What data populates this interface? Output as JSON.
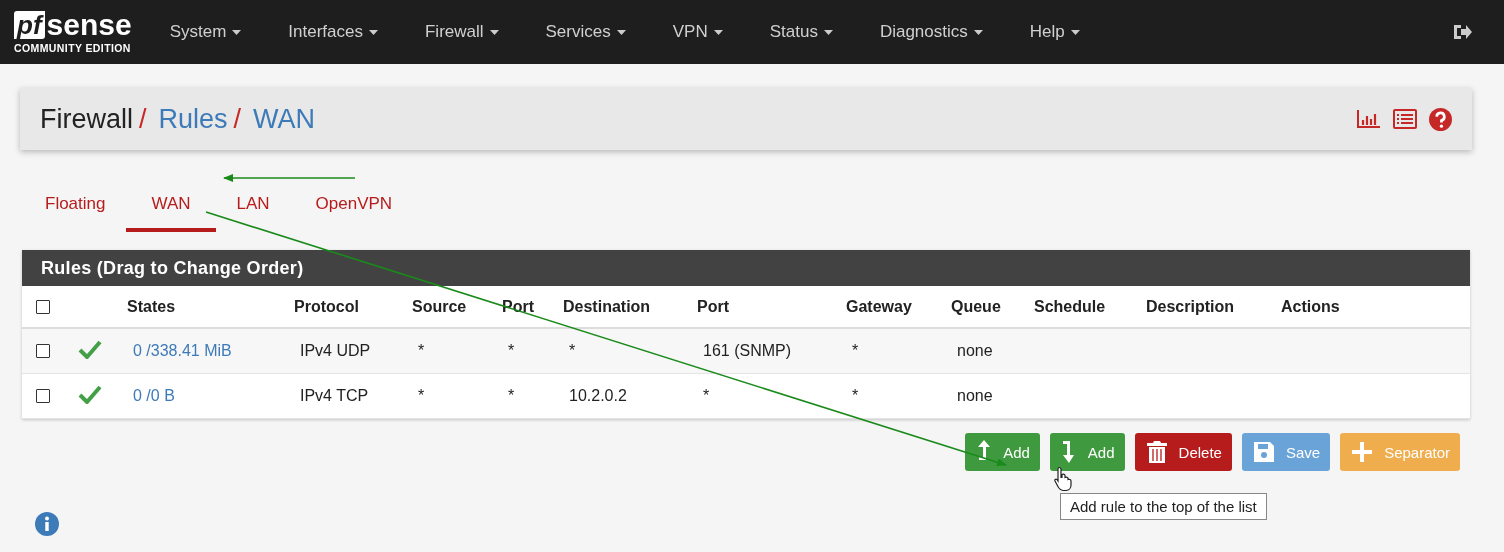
{
  "navbar": {
    "logo": {
      "mark": "pf",
      "word": "sense",
      "edition": "COMMUNITY EDITION"
    },
    "menus": [
      {
        "label": "System"
      },
      {
        "label": "Interfaces"
      },
      {
        "label": "Firewall"
      },
      {
        "label": "Services"
      },
      {
        "label": "VPN"
      },
      {
        "label": "Status"
      },
      {
        "label": "Diagnostics"
      },
      {
        "label": "Help"
      }
    ]
  },
  "breadcrumb": [
    {
      "label": "Firewall",
      "kind": "text"
    },
    {
      "label": "/",
      "kind": "separator"
    },
    {
      "label": "Rules",
      "kind": "link"
    },
    {
      "label": "/",
      "kind": "separator"
    },
    {
      "label": "WAN",
      "kind": "link"
    }
  ],
  "tabs": [
    {
      "label": "Floating",
      "selected": false
    },
    {
      "label": "WAN",
      "selected": true
    },
    {
      "label": "LAN",
      "selected": false
    },
    {
      "label": "OpenVPN",
      "selected": false
    }
  ],
  "rules_panel": {
    "title": "Rules (Drag to Change Order)",
    "select_all_checked": false,
    "columns": [
      "States",
      "Protocol",
      "Source",
      "Port",
      "Destination",
      "Port",
      "Gateway",
      "Queue",
      "Schedule",
      "Description",
      "Actions"
    ],
    "rows": [
      {
        "checked": false,
        "enabled": true,
        "states": "0 /338.41 MiB",
        "protocol": "IPv4 UDP",
        "source": "*",
        "source_port": "*",
        "destination": "*",
        "destination_port": "161 (SNMP)",
        "gateway": "*",
        "queue": "none"
      },
      {
        "checked": false,
        "enabled": true,
        "states": "0 /0 B",
        "protocol": "IPv4 TCP",
        "source": "*",
        "source_port": "*",
        "destination": "10.2.0.2",
        "destination_port": "*",
        "gateway": "*",
        "queue": "none"
      }
    ]
  },
  "buttons": [
    {
      "label": "Add",
      "kind": "add-top"
    },
    {
      "label": "Add",
      "kind": "add-bottom"
    },
    {
      "label": "Delete",
      "kind": "delete"
    },
    {
      "label": "Save",
      "kind": "save"
    },
    {
      "label": "Separator",
      "kind": "separator"
    }
  ],
  "tooltip": "Add rule to the top of the list"
}
